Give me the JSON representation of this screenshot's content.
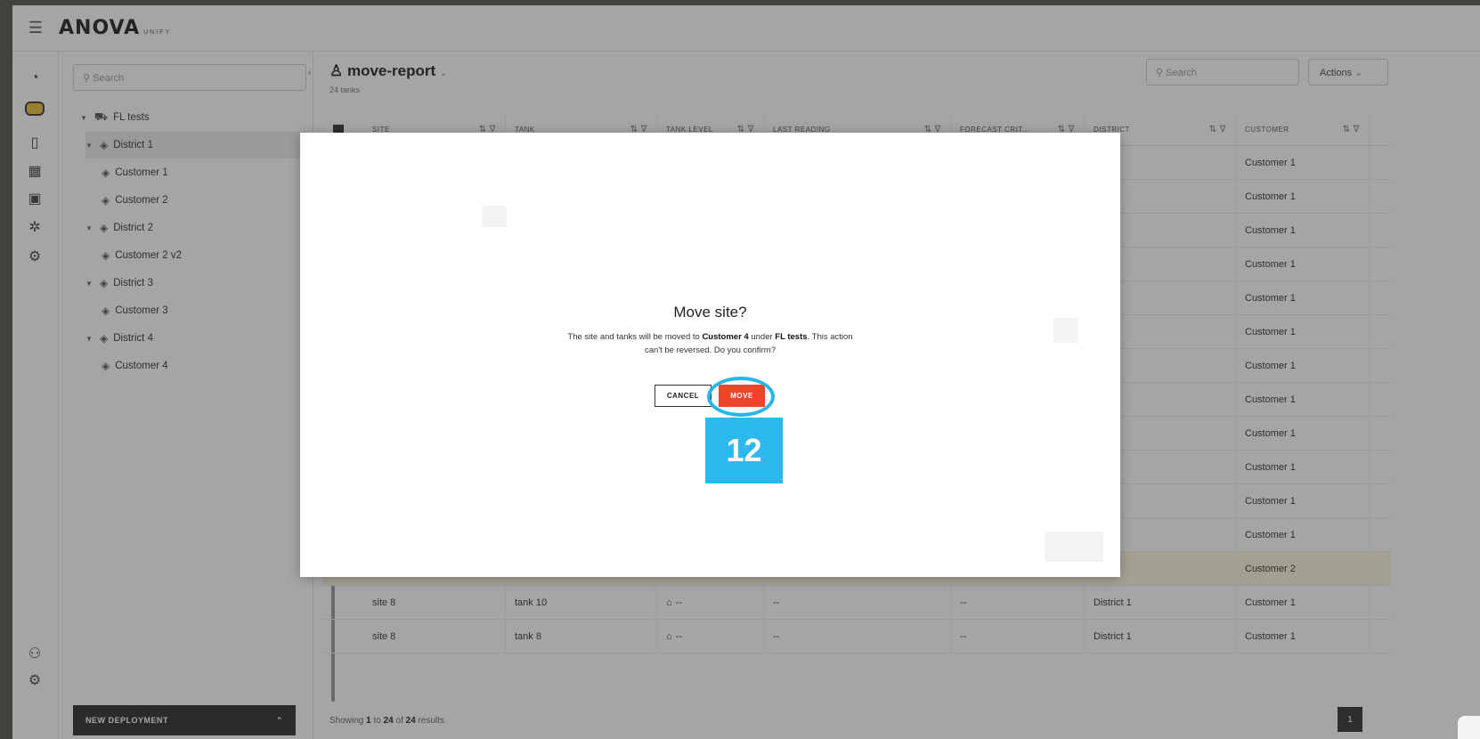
{
  "app": {
    "logo": "ANOVA",
    "logo_sub": "UNIFY",
    "menu_icon": "hamburger-icon"
  },
  "rail": {
    "items": [
      "dashboard-gauge-icon",
      "tank-icon",
      "device-signal-icon",
      "report-grid-icon",
      "analytics-icon",
      "network-icon",
      "chip-icon"
    ],
    "bottom": [
      "users-icon",
      "settings-gear-icon"
    ]
  },
  "tree": {
    "search_placeholder": "Search",
    "items": [
      {
        "label": "FL tests",
        "level": 0,
        "icon": "truck-icon"
      },
      {
        "label": "District 1",
        "level": 1,
        "icon": "layers-icon"
      },
      {
        "label": "Customer 1",
        "level": 2,
        "icon": "layers-icon"
      },
      {
        "label": "Customer 2",
        "level": 2,
        "icon": "layers-icon"
      },
      {
        "label": "District 2",
        "level": 1,
        "icon": "layers-icon"
      },
      {
        "label": "Customer 2 v2",
        "level": 2,
        "icon": "layers-icon"
      },
      {
        "label": "District 3",
        "level": 1,
        "icon": "layers-icon"
      },
      {
        "label": "Customer 3",
        "level": 2,
        "icon": "layers-icon"
      },
      {
        "label": "District 4",
        "level": 1,
        "icon": "layers-icon"
      },
      {
        "label": "Customer 4",
        "level": 2,
        "icon": "layers-icon"
      }
    ],
    "new_deployment": "NEW DEPLOYMENT"
  },
  "main": {
    "title": "move-report",
    "subtitle": "24 tanks",
    "search_placeholder": "Search",
    "actions_label": "Actions",
    "columns": [
      "SITE",
      "TANK",
      "TANK LEVEL",
      "LAST READING",
      "FORECAST CRIT...",
      "DISTRICT",
      "CUSTOMER"
    ],
    "visible_rows": [
      {
        "district": "ct 1",
        "customer": "Customer 1"
      },
      {
        "district": "ct 1",
        "customer": "Customer 1"
      },
      {
        "district": "ct 1",
        "customer": "Customer 1"
      },
      {
        "district": "ct 1",
        "customer": "Customer 1"
      },
      {
        "district": "ct 1",
        "customer": "Customer 1"
      },
      {
        "district": "ct 1",
        "customer": "Customer 1"
      },
      {
        "district": "ct 1",
        "customer": "Customer 1"
      },
      {
        "district": "ct 1",
        "customer": "Customer 1"
      },
      {
        "district": "ct 1",
        "customer": "Customer 1"
      },
      {
        "district": "ct 1",
        "customer": "Customer 1"
      },
      {
        "district": "ct 1",
        "customer": "Customer 1"
      },
      {
        "district": "ct 1",
        "customer": "Customer 1"
      },
      {
        "district": "ct 1",
        "customer": "Customer 2"
      }
    ],
    "bottom_rows": [
      {
        "site": "site 8",
        "tank": "tank 10",
        "level": "--",
        "reading": "--",
        "forecast": "--",
        "district": "District 1",
        "customer": "Customer 1"
      },
      {
        "site": "site 8",
        "tank": "tank 8",
        "level": "--",
        "reading": "--",
        "forecast": "--",
        "district": "District 1",
        "customer": "Customer 1"
      }
    ],
    "footer": {
      "prefix": "Showing",
      "from": "1",
      "to_word": "to",
      "to": "24",
      "of_word": "of",
      "total": "24",
      "suffix": "results"
    },
    "page": "1"
  },
  "dialog": {
    "title": "Move site?",
    "body_1": "The site and tanks will be moved to ",
    "customer": "Customer 4",
    "body_2": " under ",
    "parent": "FL tests",
    "body_3": ". This action can't be reversed. Do you confirm?",
    "cancel_label": "CANCEL",
    "move_label": "MOVE"
  },
  "annotation": {
    "step": "12",
    "color": "#2db8ee"
  }
}
